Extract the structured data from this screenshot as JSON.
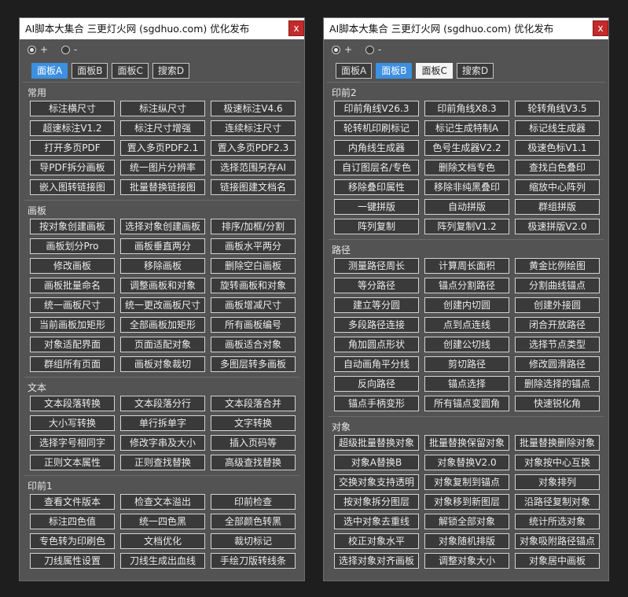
{
  "left_panel": {
    "title": "AI脚本大集合 三更灯火网 (sgdhuo.com) 优化发布",
    "close": "x",
    "radio_plus": "+",
    "radio_minus": "-",
    "tabs": [
      "面板A",
      "面板B",
      "面板C",
      "搜索D"
    ],
    "sections": [
      {
        "label": "常用",
        "buttons": [
          "标注横尺寸",
          "标注纵尺寸",
          "极速标注V4.6",
          "超速标注V1.2",
          "标注尺寸增强",
          "连续标注尺寸",
          "打开多页PDF",
          "置入多页PDF2.1",
          "置入多页PDF2.3",
          "导PDF拆分画板",
          "统一图片分辨率",
          "选择范围另存AI",
          "嵌入图转链接图",
          "批量替换链接图",
          "链接图建文档名"
        ]
      },
      {
        "label": "画板",
        "buttons": [
          "按对象创建画板",
          "选择对象创建画板",
          "排序/加框/分割",
          "画板划分Pro",
          "画板垂直两分",
          "画板水平两分",
          "修改画板",
          "移除画板",
          "删除空白画板",
          "画板批量命名",
          "调整画板和对象",
          "旋转画板和对象",
          "统一画板尺寸",
          "统一更改画板尺寸",
          "画板增减尺寸",
          "当前画板加矩形",
          "全部画板加矩形",
          "所有画板编号",
          "对象适配界面",
          "页面适配对象",
          "画板适合对象",
          "群组所有页面",
          "画板对象裁切",
          "多图层转多画板"
        ]
      },
      {
        "label": "文本",
        "buttons": [
          "文本段落转换",
          "文本段落分行",
          "文本段落合并",
          "大小写转换",
          "单行拆单字",
          "文字转换",
          "选择字号相同字",
          "修改字串及大小",
          "插入页码等",
          "正则文本属性",
          "正则查找替换",
          "高级查找替换"
        ]
      },
      {
        "label": "印前1",
        "buttons": [
          "查看文件版本",
          "检查文本溢出",
          "印前检查",
          "标注四色值",
          "统一四色黑",
          "全部颜色转黑",
          "专色转为印刷色",
          "文档优化",
          "裁切标记",
          "刀线属性设置",
          "刀线生成出血线",
          "手绘刀版转线条"
        ]
      }
    ]
  },
  "right_panel": {
    "title": "AI脚本大集合 三更灯火网 (sgdhuo.com) 优化发布",
    "close": "x",
    "radio_plus": "+",
    "radio_minus": "-",
    "tabs": [
      "面板A",
      "面板B",
      "面板C",
      "搜索D"
    ],
    "sections": [
      {
        "label": "印前2",
        "buttons": [
          "印前角线V26.3",
          "印前角线X8.3",
          "轮转角线V3.5",
          "轮转机印刷标记",
          "标记生成特制A",
          "标记线生成器",
          "内角线生成器",
          "色号生成器V2.2",
          "极速色标V1.1",
          "自订图层名/专色",
          "删除文档专色",
          "查找白色叠印",
          "移除叠印属性",
          "移除非纯黑叠印",
          "缩放中心阵列",
          "一键拼版",
          "自动拼版",
          "群组拼版",
          "阵列复制",
          "阵列复制V1.2",
          "极速拼版V2.0"
        ]
      },
      {
        "label": "路径",
        "buttons": [
          "测量路径周长",
          "计算周长面积",
          "黄金比例绘图",
          "等分路径",
          "锚点分割路径",
          "分割曲线锚点",
          "建立等分圆",
          "创建内切圆",
          "创建外接圆",
          "多段路径连接",
          "点到点连线",
          "闭合开放路径",
          "角加圆点形状",
          "创建公切线",
          "选择节点类型",
          "自动画角平分线",
          "剪切路径",
          "修改圆滑路径",
          "反向路径",
          "锚点选择",
          "删除选择的锚点",
          "锚点手柄变形",
          "所有锚点变圆角",
          "快速锐化角"
        ]
      },
      {
        "label": "对象",
        "buttons": [
          "超级批量替换对象",
          "批量替换保留对象",
          "批量替换删除对象",
          "对象A替换B",
          "对象替换V2.0",
          "对象按中心互换",
          "交换对象支持透明",
          "对象复制到锚点",
          "对象排列",
          "按对象拆分图层",
          "对象移到新图层",
          "沿路径复制对象",
          "选中对象去重线",
          "解锁全部对象",
          "统计所选对象",
          "校正对象水平",
          "对象随机排版",
          "对象吸附路径锚点",
          "选择对象对齐画板",
          "调整对象大小",
          "对象居中画板"
        ]
      }
    ]
  }
}
